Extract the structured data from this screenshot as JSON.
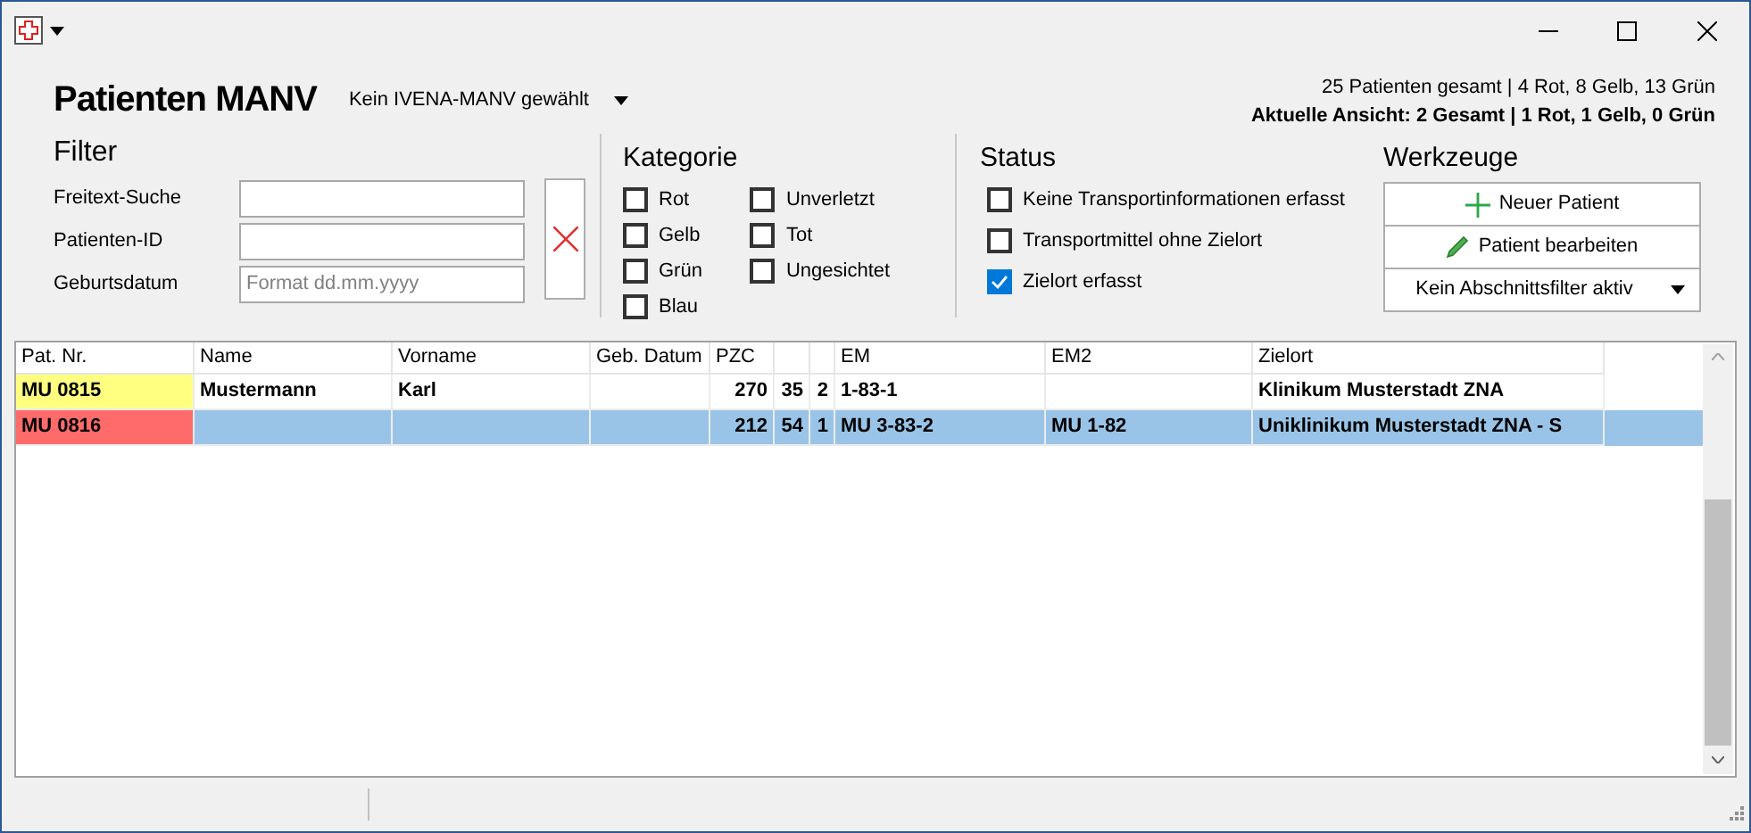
{
  "title": "Patienten MANV",
  "manv_select": {
    "value": "Kein IVENA-MANV gewählt"
  },
  "summary": {
    "total": "25 Patienten gesamt | 4 Rot, 8 Gelb, 13 Grün",
    "current": "Aktuelle Ansicht: 2 Gesamt | 1 Rot, 1 Gelb, 0 Grün"
  },
  "filter": {
    "title": "Filter",
    "fields": [
      {
        "label": "Freitext-Suche"
      },
      {
        "label": "Patienten-ID"
      },
      {
        "label": "Geburtsdatum",
        "placeholder": "Format dd.mm.yyyy"
      }
    ]
  },
  "kategorie": {
    "title": "Kategorie",
    "columns": [
      [
        {
          "label": "Rot",
          "checked": false
        },
        {
          "label": "Gelb",
          "checked": false
        },
        {
          "label": "Grün",
          "checked": false
        },
        {
          "label": "Blau",
          "checked": false
        }
      ],
      [
        {
          "label": "Unverletzt",
          "checked": false
        },
        {
          "label": "Tot",
          "checked": false
        },
        {
          "label": "Ungesichtet",
          "checked": false
        }
      ]
    ]
  },
  "status": {
    "title": "Status",
    "items": [
      {
        "label": "Keine Transportinformationen erfasst",
        "checked": false
      },
      {
        "label": "Transportmittel ohne Zielort",
        "checked": false
      },
      {
        "label": "Zielort erfasst",
        "checked": true
      }
    ]
  },
  "werkzeuge": {
    "title": "Werkzeuge",
    "buttons": [
      {
        "kind": "add",
        "label": "Neuer Patient"
      },
      {
        "kind": "edit",
        "label": "Patient bearbeiten"
      },
      {
        "kind": "dropdown",
        "label": "Kein Abschnittsfilter aktiv"
      }
    ]
  },
  "table": {
    "columns": [
      "Pat. Nr.",
      "Name",
      "Vorname",
      "Geb. Datum",
      "PZC",
      null,
      null,
      "EM",
      "EM2",
      "Zielort"
    ],
    "rows": [
      {
        "cells": [
          "MU 0815",
          "Mustermann",
          "Karl",
          null,
          "270",
          "35",
          "2",
          "1-83-1",
          null,
          "Klinikum Musterstadt ZNA"
        ],
        "color": "#ffff80",
        "selected": false
      },
      {
        "cells": [
          "MU 0816",
          null,
          null,
          null,
          "212",
          "54",
          "1",
          "MU 3-83-2",
          "MU 1-82",
          "Uniklinikum Musterstadt ZNA - S"
        ],
        "color": "#ff6b6b",
        "selected": true
      }
    ]
  }
}
